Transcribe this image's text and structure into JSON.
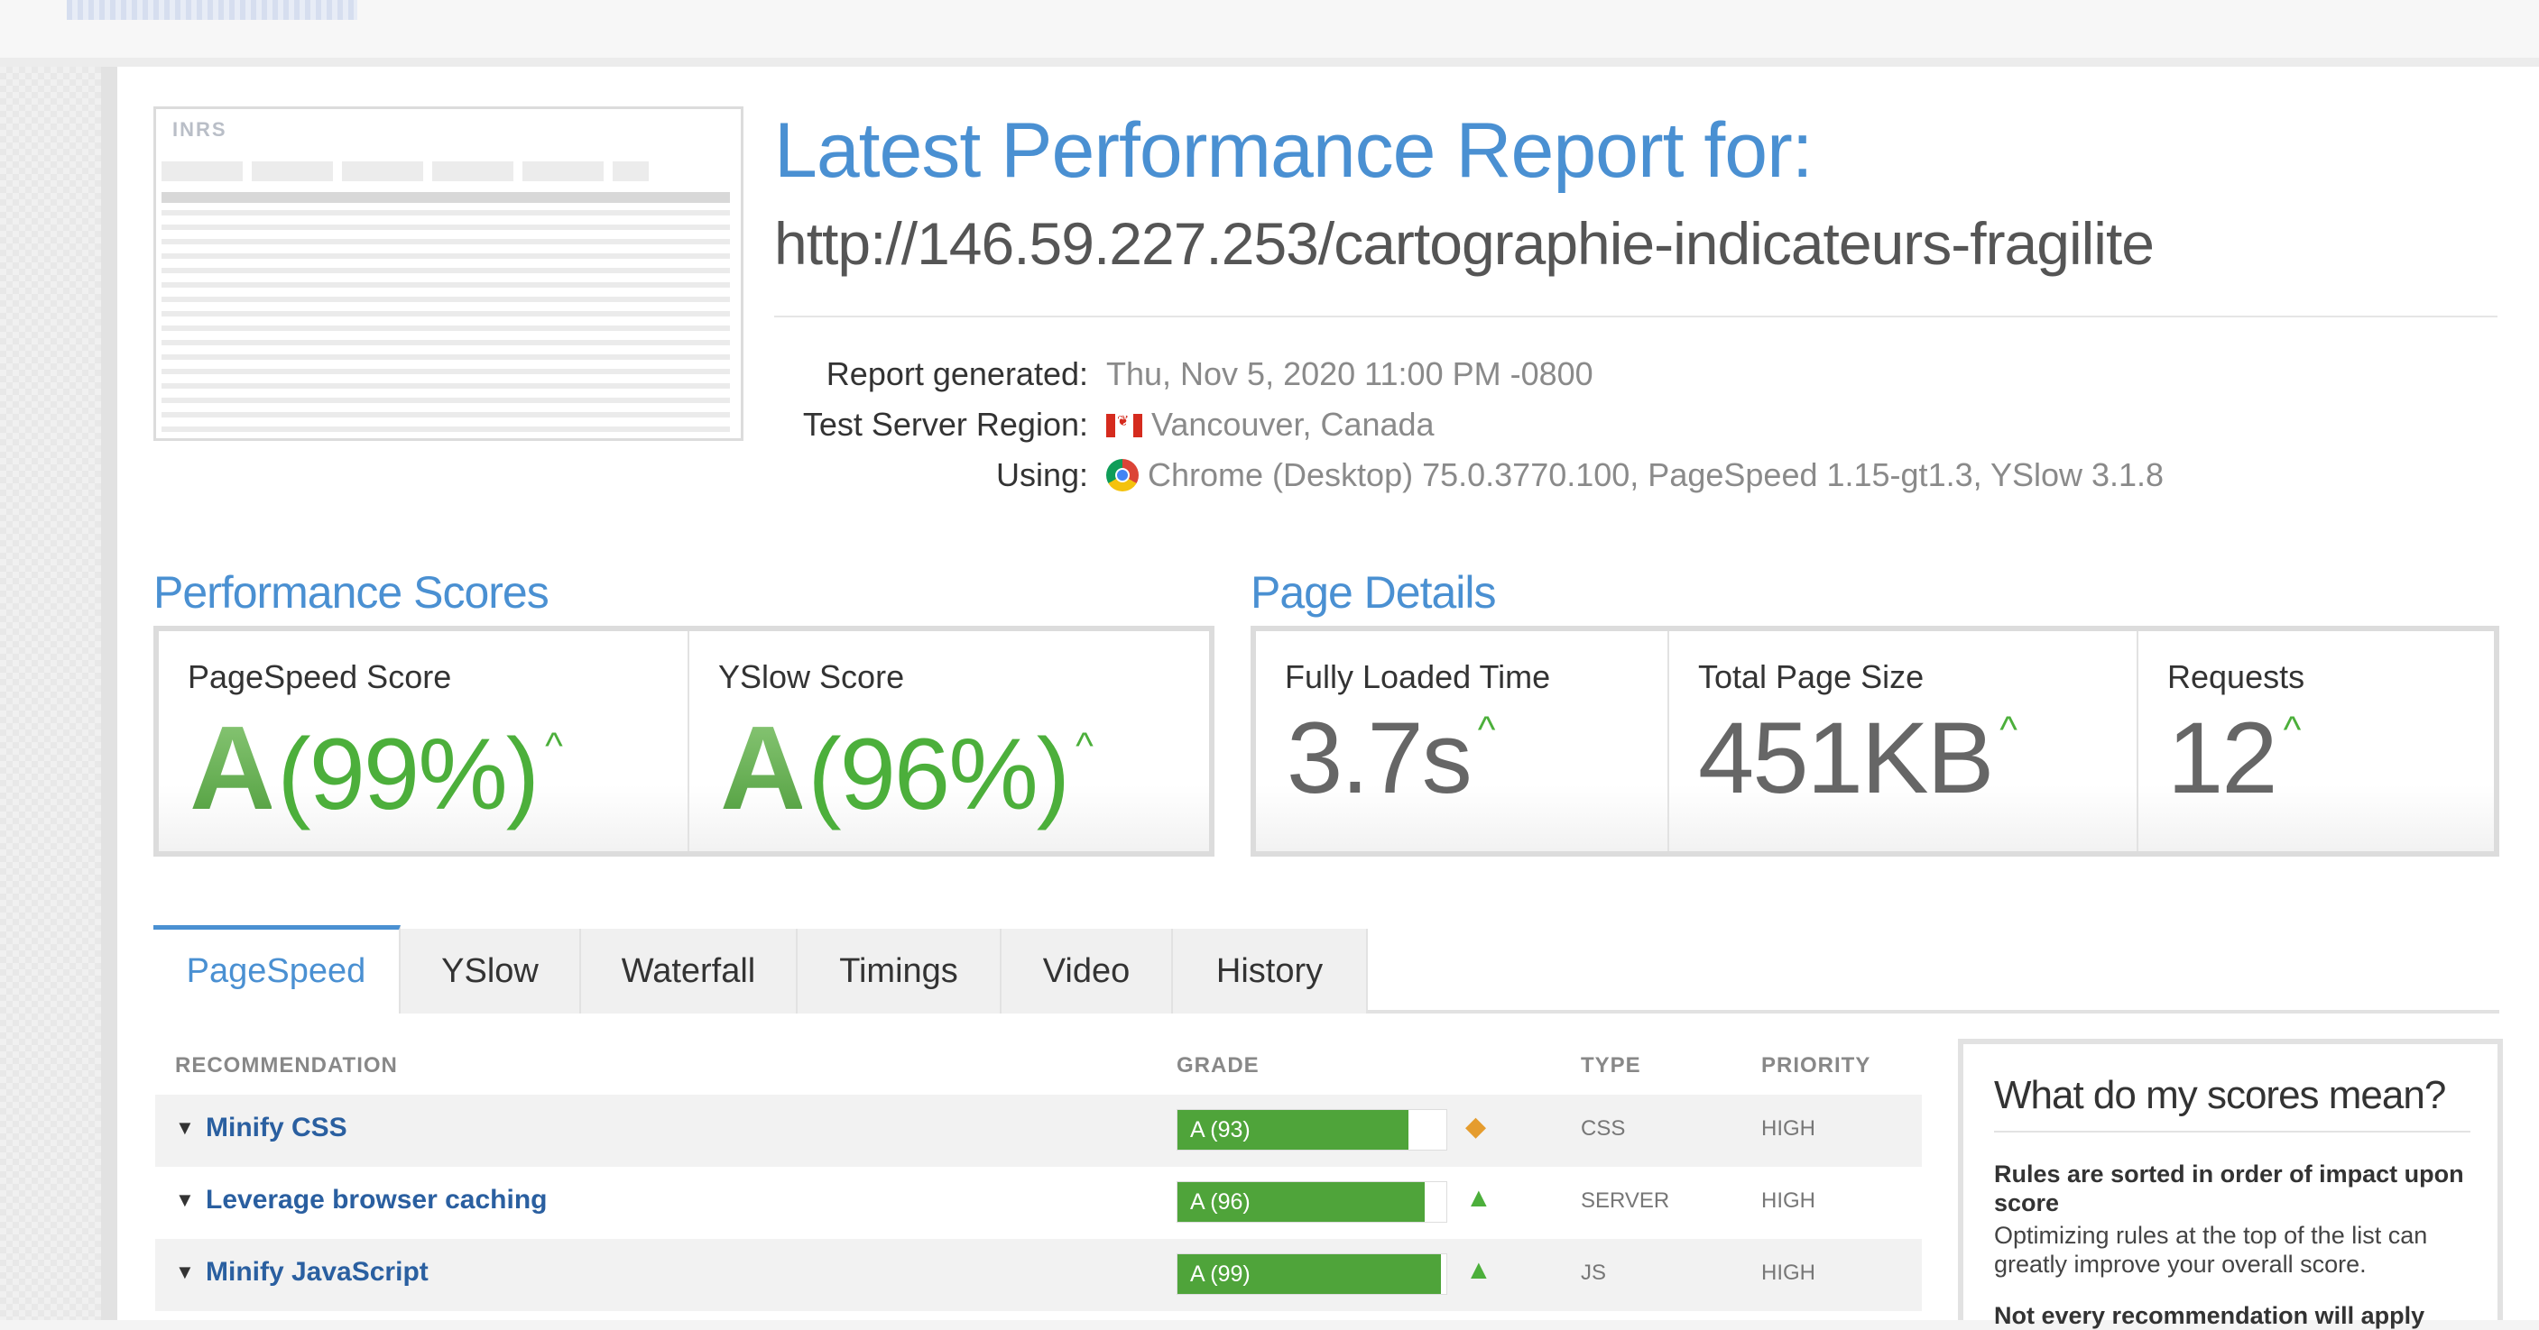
{
  "header": {
    "title": "Latest Performance Report for:",
    "url": "http://146.59.227.253/cartographie-indicateurs-fragilite"
  },
  "thumbnail": {
    "logo": "INRS"
  },
  "meta": {
    "report_generated_label": "Report generated:",
    "report_generated_value": "Thu, Nov 5, 2020 11:00 PM -0800",
    "region_label": "Test Server Region:",
    "region_value": "Vancouver, Canada",
    "using_label": "Using:",
    "using_value": "Chrome (Desktop) 75.0.3770.100, PageSpeed 1.15-gt1.3, YSlow 3.1.8"
  },
  "performance": {
    "title": "Performance Scores",
    "pagespeed_label": "PageSpeed Score",
    "pagespeed_grade": "A",
    "pagespeed_pct": "(99%)",
    "yslow_label": "YSlow Score",
    "yslow_grade": "A",
    "yslow_pct": "(96%)"
  },
  "details": {
    "title": "Page Details",
    "load_label": "Fully Loaded Time",
    "load_value": "3.7s",
    "size_label": "Total Page Size",
    "size_value": "451KB",
    "requests_label": "Requests",
    "requests_value": "12"
  },
  "tabs": [
    "PageSpeed",
    "YSlow",
    "Waterfall",
    "Timings",
    "Video",
    "History"
  ],
  "table": {
    "headers": {
      "recommendation": "RECOMMENDATION",
      "grade": "GRADE",
      "type": "TYPE",
      "priority": "PRIORITY"
    },
    "rows": [
      {
        "name": "Minify CSS",
        "grade": "A (93)",
        "score": 93,
        "type": "CSS",
        "priority": "HIGH",
        "icon": "diamond-icon"
      },
      {
        "name": "Leverage browser caching",
        "grade": "A (96)",
        "score": 96,
        "type": "SERVER",
        "priority": "HIGH",
        "icon": "up-arrow-icon"
      },
      {
        "name": "Minify JavaScript",
        "grade": "A (99)",
        "score": 99,
        "type": "JS",
        "priority": "HIGH",
        "icon": "up-arrow-icon"
      }
    ]
  },
  "sidebar": {
    "title": "What do my scores mean?",
    "strong": "Rules are sorted in order of impact upon score",
    "text": "Optimizing rules at the top of the list can greatly improve your overall score.",
    "cut": "Not every recommendation will apply"
  },
  "colors": {
    "accent": "#4a90d2",
    "grade_green": "#4fa43a",
    "warning": "#e59c2e"
  }
}
